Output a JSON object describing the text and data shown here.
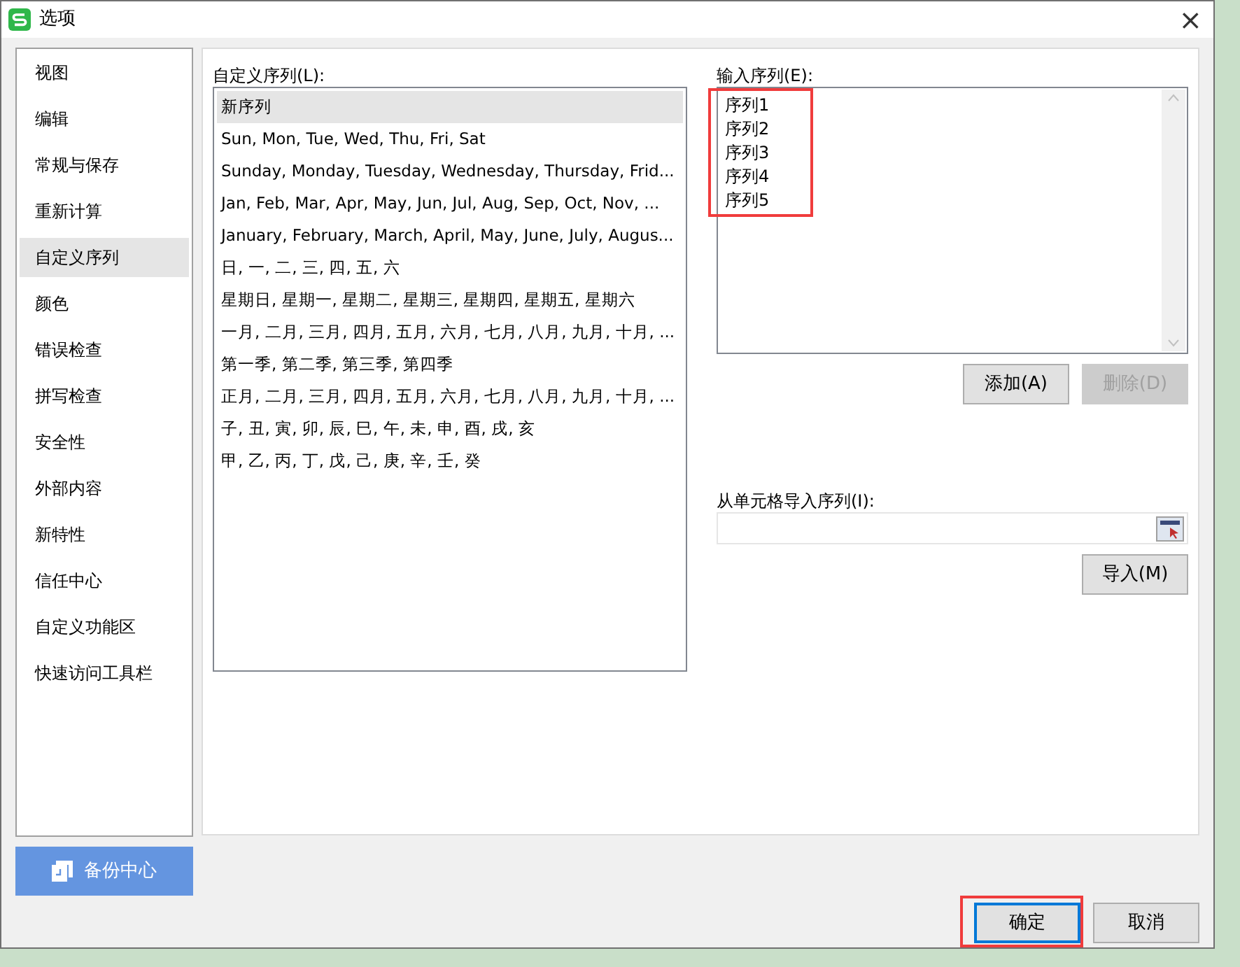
{
  "window": {
    "title": "选项",
    "close": "×"
  },
  "sidebar": {
    "items": [
      {
        "label": "视图",
        "selected": false
      },
      {
        "label": "编辑",
        "selected": false
      },
      {
        "label": "常规与保存",
        "selected": false
      },
      {
        "label": "重新计算",
        "selected": false
      },
      {
        "label": "自定义序列",
        "selected": true
      },
      {
        "label": "颜色",
        "selected": false
      },
      {
        "label": "错误检查",
        "selected": false
      },
      {
        "label": "拼写检查",
        "selected": false
      },
      {
        "label": "安全性",
        "selected": false
      },
      {
        "label": "外部内容",
        "selected": false
      },
      {
        "label": "新特性",
        "selected": false
      },
      {
        "label": "信任中心",
        "selected": false
      },
      {
        "label": "自定义功能区",
        "selected": false
      },
      {
        "label": "快速访问工具栏",
        "selected": false
      }
    ],
    "backup_button": "备份中心"
  },
  "custom_lists": {
    "label": "自定义序列(L):",
    "items": [
      {
        "text": "新序列",
        "selected": true
      },
      {
        "text": "Sun, Mon, Tue, Wed, Thu, Fri, Sat",
        "selected": false
      },
      {
        "text": "Sunday, Monday, Tuesday, Wednesday, Thursday, Frid...",
        "selected": false
      },
      {
        "text": "Jan, Feb, Mar, Apr, May, Jun, Jul, Aug, Sep, Oct, Nov, ...",
        "selected": false
      },
      {
        "text": "January, February, March, April, May, June, July, Augus...",
        "selected": false
      },
      {
        "text": "日, 一, 二, 三, 四, 五, 六",
        "selected": false
      },
      {
        "text": "星期日, 星期一, 星期二, 星期三, 星期四, 星期五, 星期六",
        "selected": false
      },
      {
        "text": "一月, 二月, 三月, 四月, 五月, 六月, 七月, 八月, 九月, 十月, ...",
        "selected": false
      },
      {
        "text": "第一季, 第二季, 第三季, 第四季",
        "selected": false
      },
      {
        "text": "正月, 二月, 三月, 四月, 五月, 六月, 七月, 八月, 九月, 十月, ...",
        "selected": false
      },
      {
        "text": "子, 丑, 寅, 卯, 辰, 巳, 午, 未, 申, 酉, 戌, 亥",
        "selected": false
      },
      {
        "text": "甲, 乙, 丙, 丁, 戊, 己, 庚, 辛, 壬, 癸",
        "selected": false
      }
    ]
  },
  "entries": {
    "label": "输入序列(E):",
    "highlighted": true,
    "lines": [
      "序列1",
      "序列2",
      "序列3",
      "序列4",
      "序列5"
    ]
  },
  "entry_buttons": [
    {
      "label": "添加(A)",
      "disabled": false
    },
    {
      "label": "删除(D)",
      "disabled": true
    }
  ],
  "import": {
    "label": "从单元格导入序列(I):",
    "button": "导入(M)"
  },
  "footer_buttons": [
    {
      "label": "确定",
      "default": true,
      "highlighted": true
    },
    {
      "label": "取消",
      "default": false,
      "highlighted": false
    }
  ]
}
